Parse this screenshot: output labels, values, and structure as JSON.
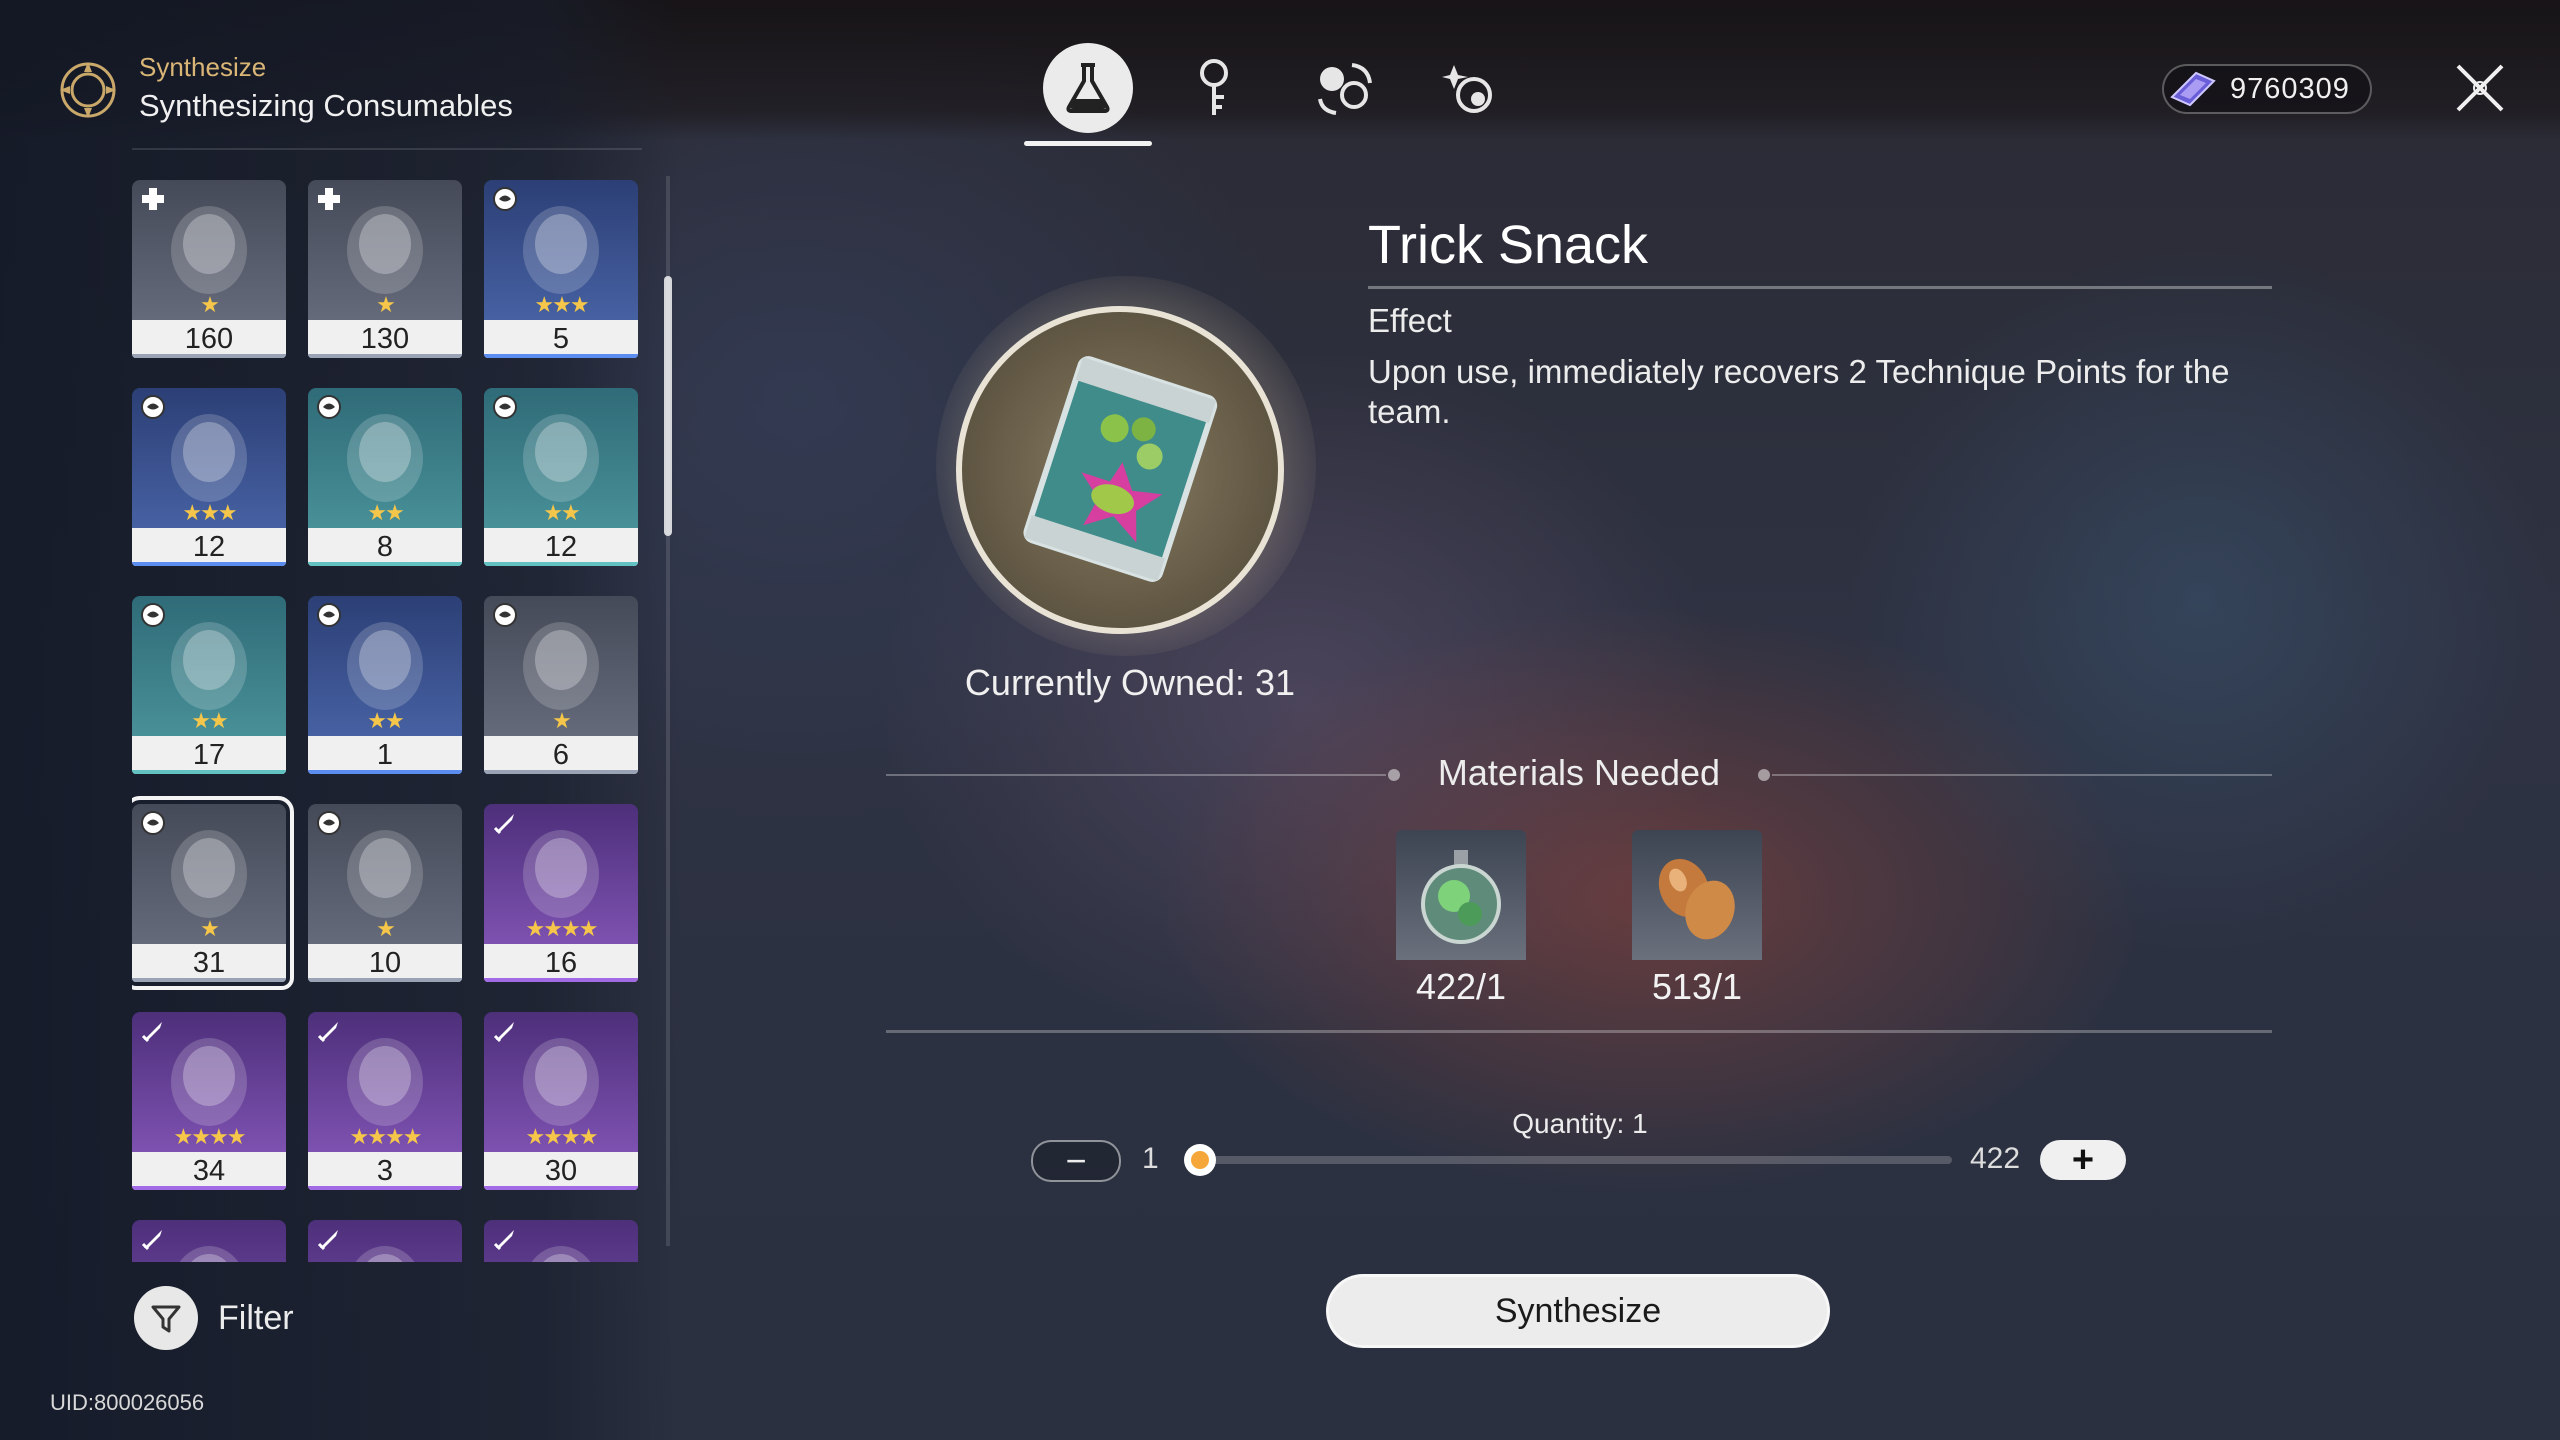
{
  "header": {
    "category": "Synthesize",
    "title": "Synthesizing Consumables",
    "icon": "synthesize-emblem-icon"
  },
  "tabs": [
    {
      "name": "flask-tab",
      "icon": "flask-icon",
      "active": true
    },
    {
      "name": "key-tab",
      "icon": "key-icon",
      "active": false
    },
    {
      "name": "materials-tab",
      "icon": "materials-icon",
      "active": false
    },
    {
      "name": "exchange-tab",
      "icon": "exchange-icon",
      "active": false
    }
  ],
  "currency": {
    "value": "9760309",
    "icon": "fuel-gem-icon"
  },
  "grid": {
    "items": [
      {
        "count": "160",
        "rarity": 2,
        "stars": "★",
        "badge": "heal-badge-icon",
        "art": "backpack-icon"
      },
      {
        "count": "130",
        "rarity": 2,
        "stars": "★",
        "badge": "heal-badge-icon",
        "art": "noodle-bowl-icon"
      },
      {
        "count": "5",
        "rarity": 4,
        "stars": "★★★",
        "badge": "technique-badge-icon",
        "art": "bottle-icon"
      },
      {
        "count": "12",
        "rarity": 4,
        "stars": "★★★",
        "badge": "technique-badge-icon",
        "art": "can-icon"
      },
      {
        "count": "8",
        "rarity": 3,
        "stars": "★★",
        "badge": "technique-badge-icon",
        "art": "dish-icon"
      },
      {
        "count": "12",
        "rarity": 3,
        "stars": "★★",
        "badge": "technique-badge-icon",
        "art": "bun-icon"
      },
      {
        "count": "17",
        "rarity": 3,
        "stars": "★★",
        "badge": "technique-badge-icon",
        "art": "red-can-icon"
      },
      {
        "count": "1",
        "rarity": 4,
        "stars": "★★",
        "badge": "technique-badge-icon",
        "art": "blue-can-icon"
      },
      {
        "count": "6",
        "rarity": 2,
        "stars": "★",
        "badge": "technique-badge-icon",
        "art": "vial-icon"
      },
      {
        "count": "31",
        "rarity": 2,
        "stars": "★",
        "badge": "technique-badge-icon",
        "art": "snack-bag-icon",
        "selected": true
      },
      {
        "count": "10",
        "rarity": 2,
        "stars": "★",
        "badge": "technique-badge-icon",
        "art": "purple-bowl-icon"
      },
      {
        "count": "16",
        "rarity": 5,
        "stars": "★★★★",
        "badge": "attack-badge-icon",
        "art": "bomb-icon"
      },
      {
        "count": "34",
        "rarity": 5,
        "stars": "★★★★",
        "badge": "attack-badge-icon",
        "art": "post-icon"
      },
      {
        "count": "3",
        "rarity": 5,
        "stars": "★★★★",
        "badge": "attack-badge-icon",
        "art": "scarf-icon"
      },
      {
        "count": "30",
        "rarity": 5,
        "stars": "★★★★",
        "badge": "attack-badge-icon",
        "art": "cannon-icon"
      },
      {
        "count": "",
        "rarity": 5,
        "stars": "",
        "badge": "attack-badge-icon",
        "art": "partial-item-icon"
      },
      {
        "count": "",
        "rarity": 5,
        "stars": "",
        "badge": "attack-badge-icon",
        "art": "partial-item-icon"
      },
      {
        "count": "",
        "rarity": 5,
        "stars": "",
        "badge": "attack-badge-icon",
        "art": "partial-item-icon"
      }
    ]
  },
  "filter": {
    "label": "Filter",
    "icon": "filter-funnel-icon"
  },
  "uid": "UID:800026056",
  "detail": {
    "name": "Trick Snack",
    "effect_heading": "Effect",
    "effect_text": "Upon use, immediately recovers 2 Technique Points for the team.",
    "owned": "Currently Owned: 31",
    "image_icon": "trick-snack-bag-icon"
  },
  "materials": {
    "heading": "Materials Needed",
    "items": [
      {
        "value": "422/1",
        "icon": "green-orb-flask-icon"
      },
      {
        "value": "513/1",
        "icon": "beans-icon"
      }
    ]
  },
  "quantity": {
    "label": "Quantity:",
    "value": "1",
    "min": "1",
    "max": "422",
    "fraction": 0
  },
  "actions": {
    "synthesize": "Synthesize"
  },
  "colors": {
    "accent": "#d9b676",
    "star": "#f5c64a",
    "slider_knob": "#f5a73a"
  }
}
